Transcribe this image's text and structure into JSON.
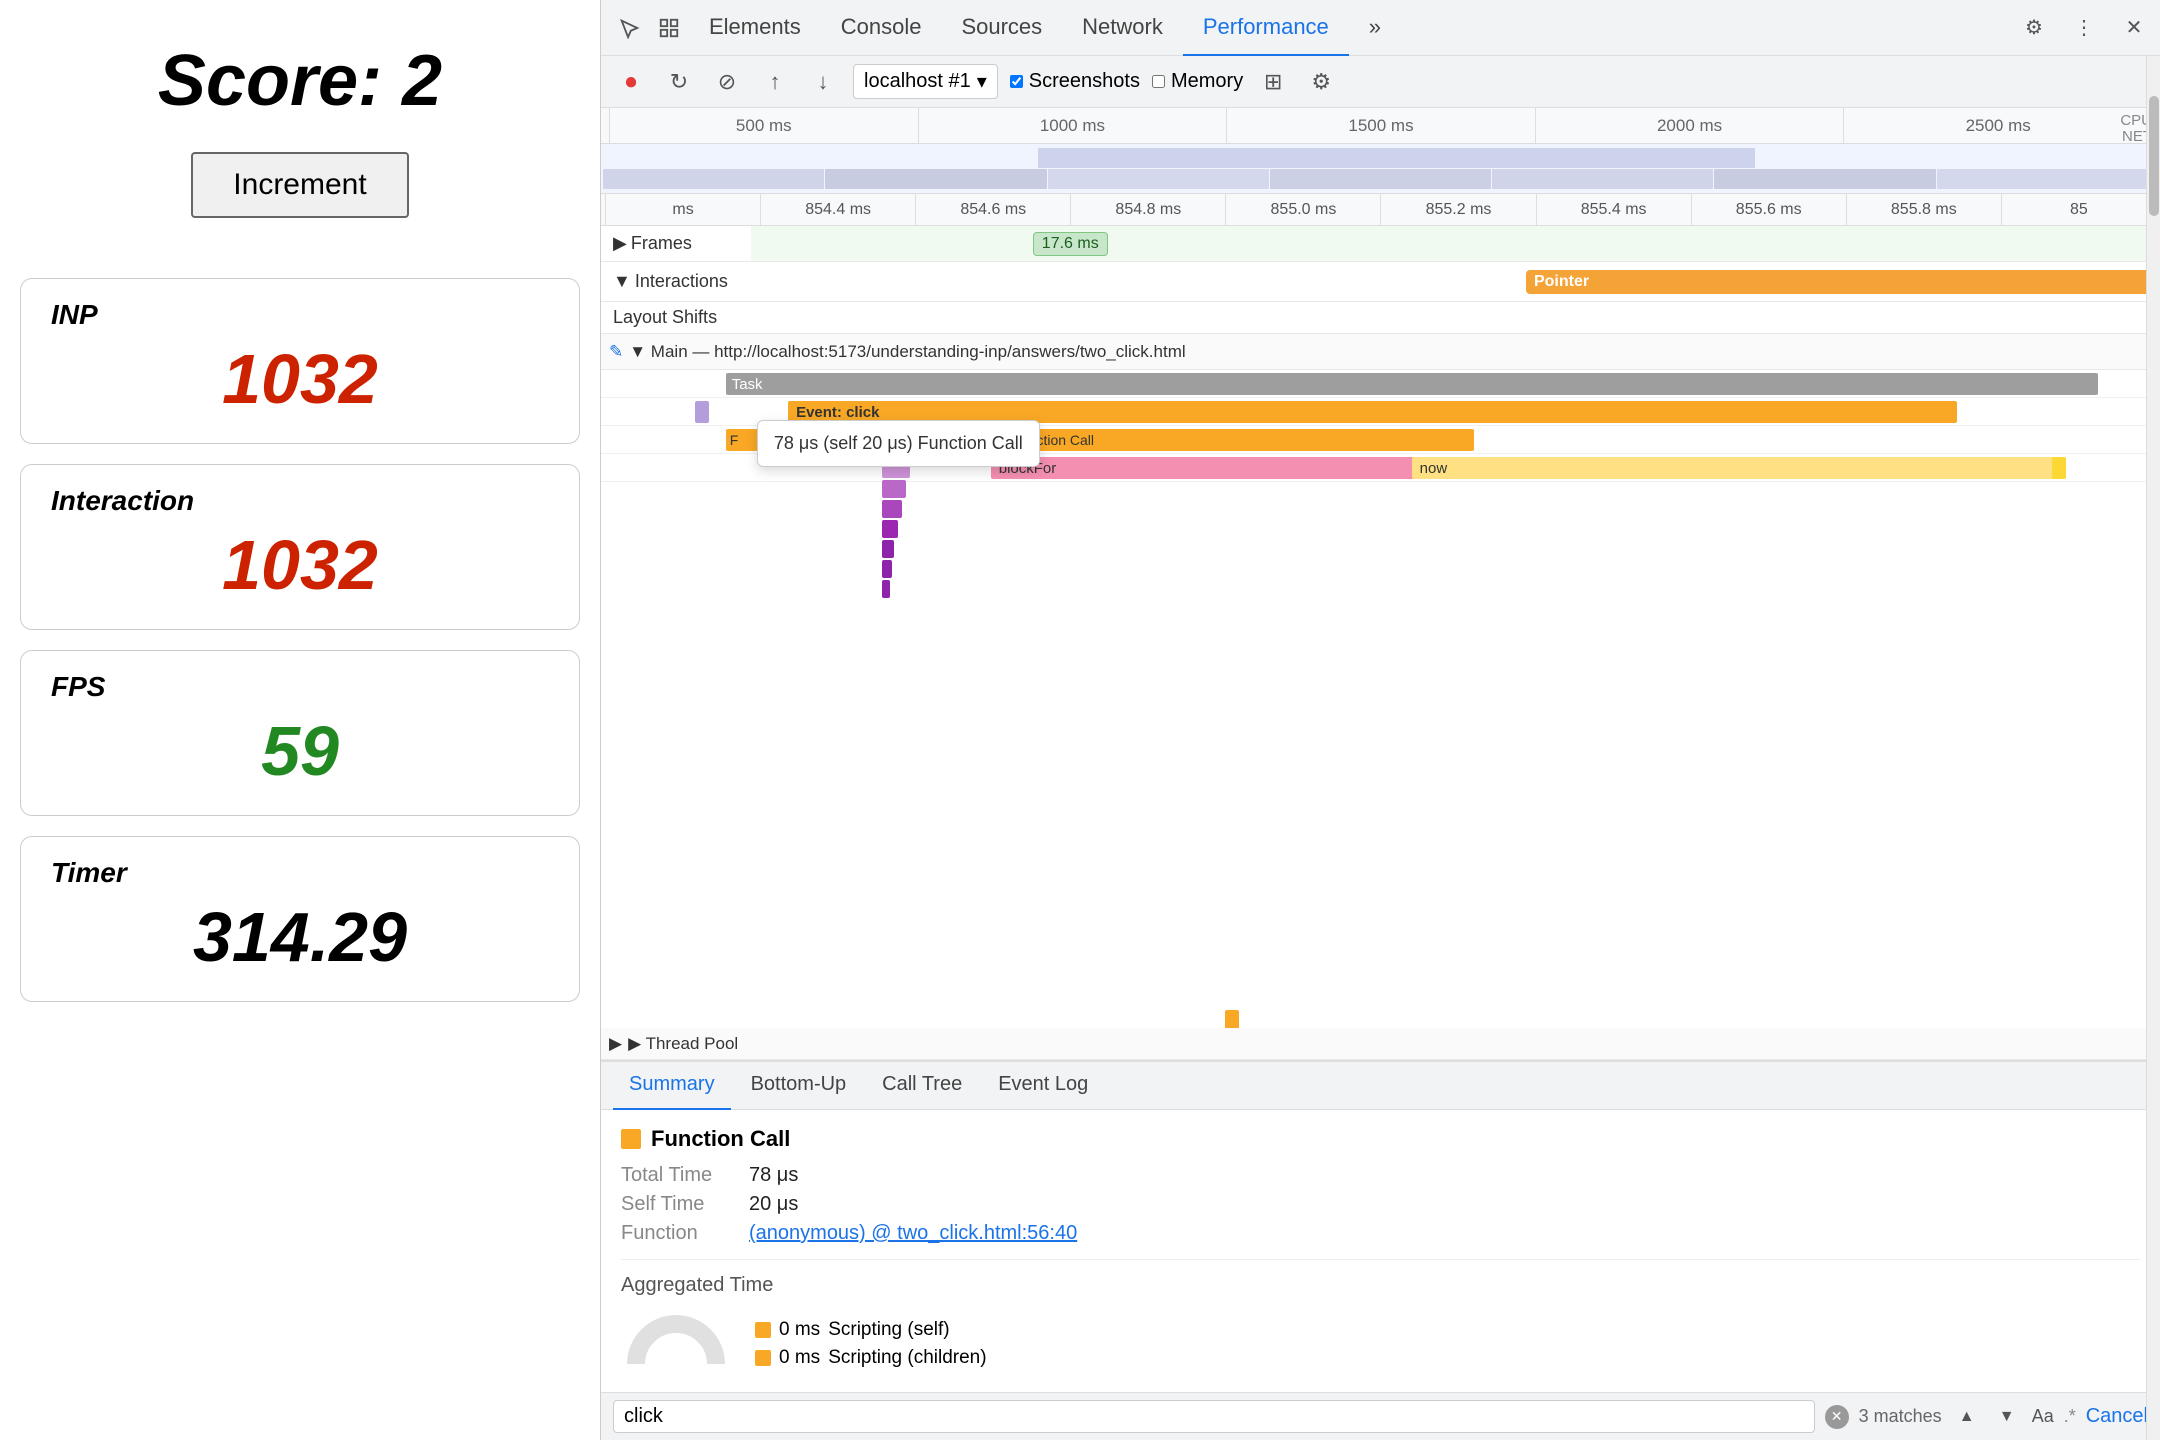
{
  "left": {
    "score_label": "Score: 2",
    "increment_btn": "Increment",
    "metrics": [
      {
        "id": "inp",
        "label": "INP",
        "value": "1032",
        "color": "red"
      },
      {
        "id": "interaction",
        "label": "Interaction",
        "value": "1032",
        "color": "red"
      },
      {
        "id": "fps",
        "label": "FPS",
        "value": "59",
        "color": "green"
      },
      {
        "id": "timer",
        "label": "Timer",
        "value": "314.29",
        "color": "black"
      }
    ]
  },
  "devtools": {
    "tabs": [
      "Elements",
      "Console",
      "Sources",
      "Network",
      "Performance",
      ">>"
    ],
    "active_tab": "Performance",
    "toolbar": {
      "selector": "localhost #1",
      "screenshots_label": "Screenshots",
      "memory_label": "Memory"
    },
    "ruler": {
      "marks": [
        "500 ms",
        "1000 ms",
        "1500 ms",
        "2000 ms",
        "2500 ms"
      ]
    },
    "cpu_label": "CPU",
    "net_label": "NET",
    "detail_ruler": {
      "marks": [
        "ms",
        "854.4 ms",
        "854.6 ms",
        "854.8 ms",
        "855.0 ms",
        "855.2 ms",
        "855.4 ms",
        "855.6 ms",
        "855.8 ms",
        "85"
      ]
    },
    "tracks": {
      "frames": {
        "label": "Frames",
        "pill": "17.6 ms"
      },
      "interactions": {
        "label": "Interactions",
        "pointer": "Pointer"
      },
      "layout_shifts": {
        "label": "Layout Shifts"
      }
    },
    "main_thread": {
      "label": "▼ Main — http://localhost:5173/understanding-inp/answers/two_click.html",
      "task_label": "Task",
      "event_label": "Event: click",
      "tooltip": "78 μs (self 20 μs)  Function Call",
      "fn_label": "Function Call",
      "blockfor_label": "blockFor",
      "now_label": "now"
    },
    "thread_pool_label": "▶ Thread Pool"
  },
  "bottom": {
    "tabs": [
      "Summary",
      "Bottom-Up",
      "Call Tree",
      "Event Log"
    ],
    "active_tab": "Summary",
    "summary": {
      "title": "Function Call",
      "total_time_label": "Total Time",
      "total_time_value": "78 μs",
      "self_time_label": "Self Time",
      "self_time_value": "20 μs",
      "function_label": "Function",
      "function_value": "(anonymous) @ two_click.html:56:40"
    },
    "aggregated": {
      "title": "Aggregated Time",
      "legend": [
        {
          "label": "Scripting (self)",
          "value": "0 ms",
          "color": "#f9a825"
        },
        {
          "label": "Scripting (children)",
          "value": "0 ms",
          "color": "#f9a825"
        }
      ]
    }
  },
  "search": {
    "value": "click",
    "match_count": "3 matches",
    "cancel_label": "Cancel"
  }
}
